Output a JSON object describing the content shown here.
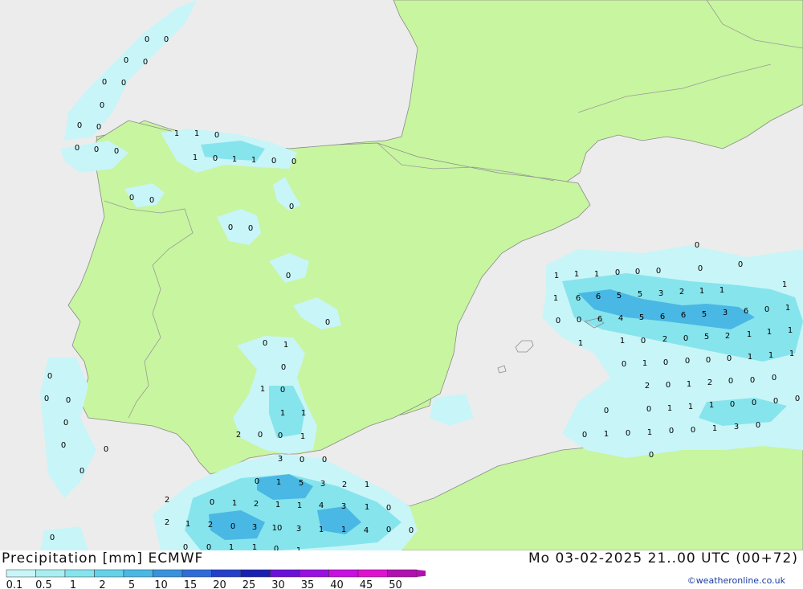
{
  "footer": {
    "title": "Precipitation [mm] ECMWF",
    "datetime": "Mo 03-02-2025 21..00 UTC (00+72)",
    "credit": "©weatheronline.co.uk"
  },
  "legend": {
    "labels": [
      "0.1",
      "0.5",
      "1",
      "2",
      "5",
      "10",
      "15",
      "20",
      "25",
      "30",
      "35",
      "40",
      "45",
      "50"
    ],
    "colors": [
      "#c8f5f8",
      "#a8eef2",
      "#86e4ec",
      "#64d2e8",
      "#4ab8e4",
      "#3a92dc",
      "#2f6cd8",
      "#2440c8",
      "#1a20b0",
      "#6a10d8",
      "#9a10e0",
      "#c810e0",
      "#e010d0",
      "#b010b0"
    ]
  },
  "colors": {
    "sea": "#ececec",
    "land": "#c8f5a0",
    "precip_light": "#c8f5f8",
    "precip_medium": "#86e4ec",
    "precip_heavy": "#4ab8e4"
  },
  "map_values": {
    "atlantic_north": [
      "0",
      "0",
      "0",
      "0",
      "0",
      "0",
      "0",
      "0",
      "0",
      "0",
      "0",
      "0",
      "0"
    ],
    "cantabrian_coast": [
      "1",
      "1",
      "0",
      "1",
      "0",
      "1",
      "1",
      "0",
      "0",
      "0",
      "0"
    ],
    "central_iberia": [
      "0",
      "0",
      "0",
      "0",
      "0",
      "1",
      "0",
      "1",
      "0",
      "1",
      "1",
      "2",
      "0",
      "0",
      "1",
      "0"
    ],
    "balearic_sea": [
      "0",
      "0",
      "0",
      "1",
      "1",
      "1",
      "0",
      "0",
      "0",
      "1",
      "6",
      "6",
      "5",
      "5",
      "3",
      "2",
      "1",
      "1",
      "1",
      "0",
      "0",
      "6",
      "4",
      "5",
      "6",
      "6",
      "5",
      "3",
      "6",
      "0",
      "1",
      "1",
      "1",
      "0",
      "2",
      "0",
      "5",
      "2",
      "1",
      "1",
      "1",
      "0",
      "1",
      "0",
      "0",
      "0",
      "0",
      "1",
      "1",
      "1",
      "2",
      "0",
      "1",
      "2",
      "0",
      "0",
      "0",
      "0",
      "0",
      "1",
      "1",
      "1",
      "0",
      "0",
      "0",
      "0",
      "0",
      "1",
      "0",
      "1",
      "0",
      "0",
      "1",
      "3",
      "0",
      "0"
    ],
    "alboran": [
      "3",
      "0",
      "0",
      "1",
      "5",
      "3",
      "2",
      "1",
      "0",
      "1",
      "2",
      "1",
      "1",
      "4",
      "3",
      "1",
      "2",
      "0",
      "3",
      "10",
      "3",
      "1",
      "1",
      "4",
      "2",
      "2",
      "1",
      "0",
      "0",
      "0",
      "0",
      "0",
      "1",
      "1",
      "0",
      "1"
    ],
    "atlantic_south": [
      "0",
      "0",
      "0",
      "0",
      "0",
      "0",
      "0",
      "0"
    ]
  }
}
